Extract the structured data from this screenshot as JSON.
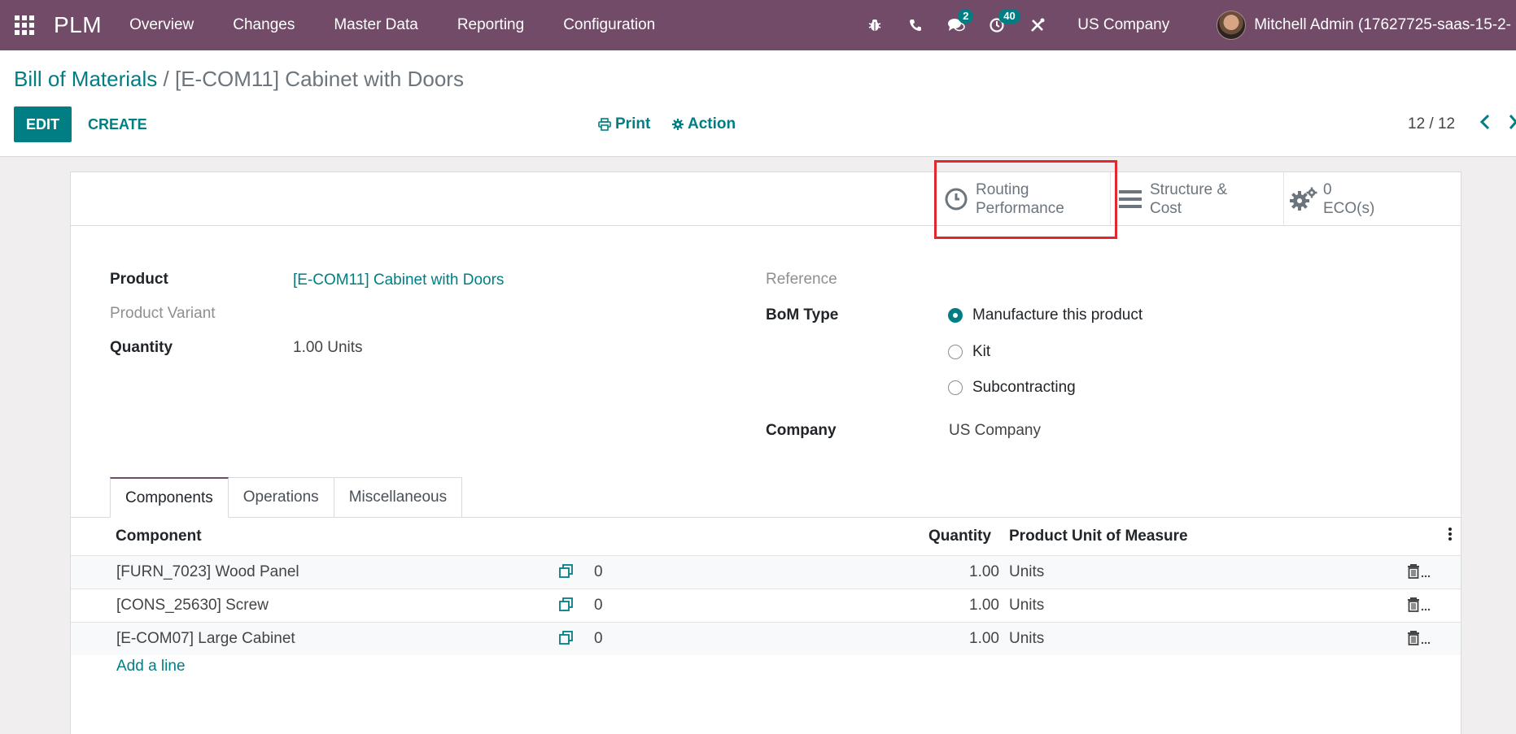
{
  "navbar": {
    "brand": "PLM",
    "menu": [
      "Overview",
      "Changes",
      "Master Data",
      "Reporting",
      "Configuration"
    ],
    "icons": [
      "bug-icon",
      "phone-icon",
      "chat-icon",
      "activity-clock-icon",
      "tools-icon"
    ],
    "messages_badge": "2",
    "activities_badge": "40",
    "company": "US Company",
    "user": "Mitchell Admin (17627725-saas-15-2-"
  },
  "control": {
    "breadcrumb_parent": "Bill of Materials",
    "breadcrumb_sep": "/",
    "breadcrumb_current": "[E-COM11] Cabinet with Doors",
    "edit_label": "EDIT",
    "create_label": "CREATE",
    "print_label": "Print",
    "action_label": "Action",
    "pager": "12 / 12"
  },
  "stat_buttons": {
    "routing_line1": "Routing",
    "routing_line2": "Performance",
    "structure_line1": "Structure &",
    "structure_line2": "Cost",
    "eco_count": "0",
    "eco_label": "ECO(s)"
  },
  "form": {
    "product_label": "Product",
    "product_value": "[E-COM11] Cabinet with Doors",
    "variant_label": "Product Variant",
    "quantity_label": "Quantity",
    "quantity_value": "1.00",
    "quantity_uom": "Units",
    "reference_label": "Reference",
    "bom_type_label": "BoM Type",
    "bom_types": [
      {
        "label": "Manufacture this product",
        "checked": true
      },
      {
        "label": "Kit",
        "checked": false
      },
      {
        "label": "Subcontracting",
        "checked": false
      }
    ],
    "company_label": "Company",
    "company_value": "US Company"
  },
  "tabs": [
    {
      "label": "Components",
      "active": true
    },
    {
      "label": "Operations",
      "active": false
    },
    {
      "label": "Miscellaneous",
      "active": false
    }
  ],
  "table": {
    "headers": {
      "component": "Component",
      "quantity": "Quantity",
      "uom": "Product Unit of Measure"
    },
    "rows": [
      {
        "component": "[FURN_7023] Wood Panel",
        "count": "0",
        "quantity": "1.00",
        "uom": "Units"
      },
      {
        "component": "[CONS_25630] Screw",
        "count": "0",
        "quantity": "1.00",
        "uom": "Units"
      },
      {
        "component": "[E-COM07] Large Cabinet",
        "count": "0",
        "quantity": "1.00",
        "uom": "Units"
      }
    ],
    "add_line": "Add a line"
  },
  "colors": {
    "navbar": "#714b67",
    "primary": "#017e84",
    "highlight": "#e0282e"
  }
}
